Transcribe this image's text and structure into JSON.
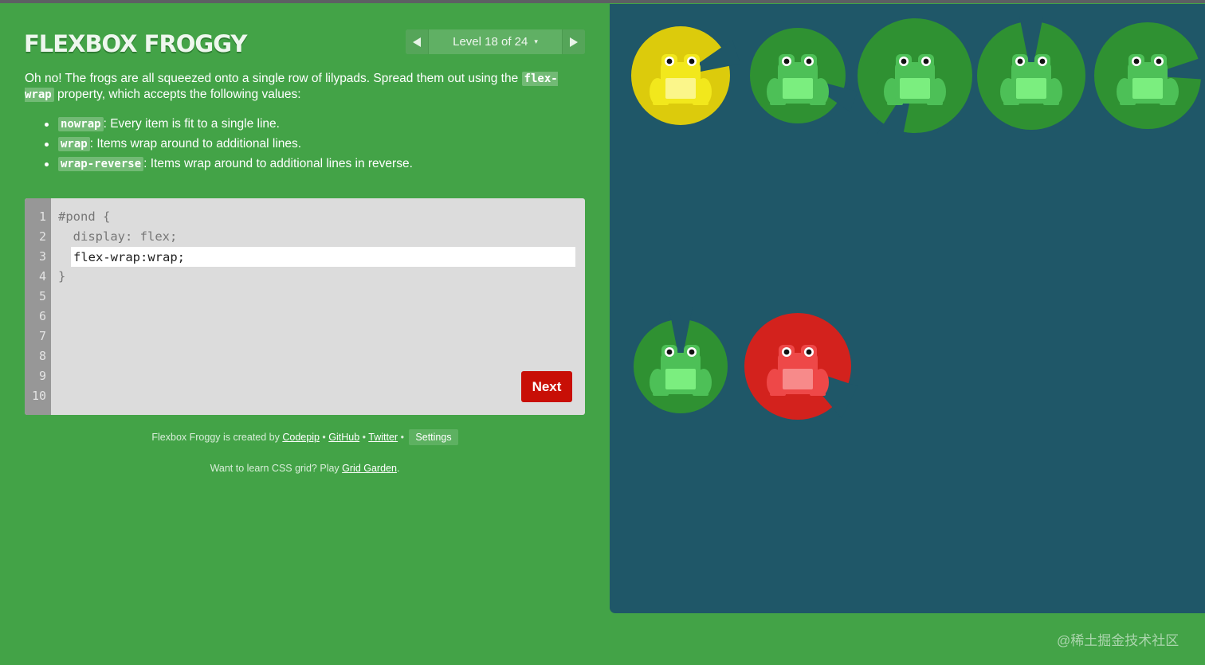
{
  "app": {
    "title": "FLEXBOX FROGGY"
  },
  "level_nav": {
    "label": "Level 18 of 24",
    "caret": "▾",
    "prev_icon": "triangle-left",
    "next_icon": "triangle-right"
  },
  "instructions": {
    "text_before": "Oh no! The frogs are all squeezed onto a single row of lilypads. Spread them out using the ",
    "property": "flex-wrap",
    "text_after": " property, which accepts the following values:"
  },
  "values": [
    {
      "keyword": "nowrap",
      "description": ": Every item is fit to a single line."
    },
    {
      "keyword": "wrap",
      "description": ": Items wrap around to additional lines."
    },
    {
      "keyword": "wrap-reverse",
      "description": ": Items wrap around to additional lines in reverse."
    }
  ],
  "editor": {
    "line_numbers": [
      "1",
      "2",
      "3",
      "4",
      "5",
      "6",
      "7",
      "8",
      "9",
      "10"
    ],
    "lines": [
      "#pond {",
      "  display: flex;",
      "",
      "}"
    ],
    "input_value": "flex-wrap:wrap;",
    "next_label": "Next"
  },
  "credits": {
    "prefix": "Flexbox Froggy is created by ",
    "links": [
      "Codepip",
      "GitHub",
      "Twitter"
    ],
    "separator": " • ",
    "settings_label": "Settings"
  },
  "promo": {
    "prefix": "Want to learn CSS grid? Play ",
    "link": "Grid Garden",
    "suffix": "."
  },
  "pond": {
    "frogs": [
      {
        "color": "yellow",
        "pad": "#dccb0c",
        "body": "#f2e81c",
        "belly": "#fbf68a"
      },
      {
        "color": "green",
        "pad": "#2f9132",
        "body": "#4dc057",
        "belly": "#7bee7f"
      },
      {
        "color": "green",
        "pad": "#2f9132",
        "body": "#4dc057",
        "belly": "#7bee7f"
      },
      {
        "color": "green",
        "pad": "#2f9132",
        "body": "#4dc057",
        "belly": "#7bee7f"
      },
      {
        "color": "green",
        "pad": "#2f9132",
        "body": "#4dc057",
        "belly": "#7bee7f"
      },
      {
        "color": "green",
        "pad": "#2f9132",
        "body": "#4dc057",
        "belly": "#7bee7f"
      },
      {
        "color": "red",
        "pad": "#d3221d",
        "body": "#ee4848",
        "belly": "#f78a8a"
      }
    ]
  },
  "watermark": "@稀土掘金技术社区",
  "colors": {
    "background": "#43a347",
    "pond": "#1f5768",
    "next_button": "#c80f06"
  }
}
